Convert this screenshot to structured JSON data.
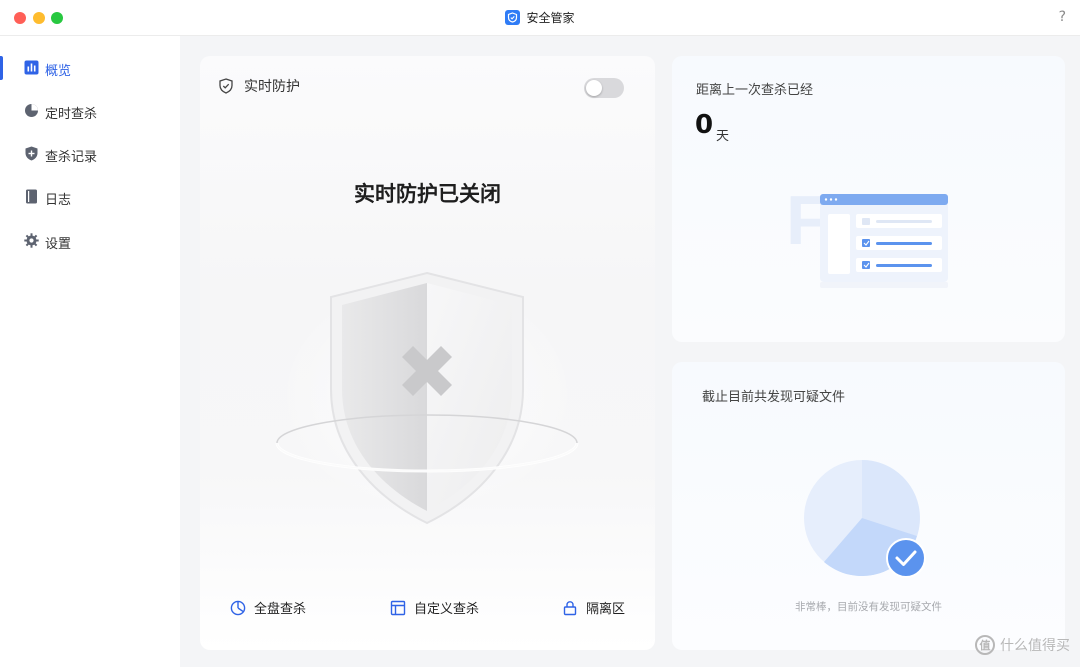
{
  "window": {
    "title": "安全管家",
    "help": "?"
  },
  "sidebar": {
    "items": [
      {
        "label": "概览",
        "icon": "overview-chart-icon",
        "active": true
      },
      {
        "label": "定时查杀",
        "icon": "clock-pie-icon",
        "active": false
      },
      {
        "label": "查杀记录",
        "icon": "shield-plus-icon",
        "active": false
      },
      {
        "label": "日志",
        "icon": "notebook-icon",
        "active": false
      },
      {
        "label": "设置",
        "icon": "gear-icon",
        "active": false
      }
    ]
  },
  "realtime": {
    "label": "实时防护",
    "enabled": false,
    "status_text": "实时防护已关闭"
  },
  "actions": {
    "full_scan": "全盘查杀",
    "custom_scan": "自定义查杀",
    "quarantine": "隔离区"
  },
  "last_scan": {
    "label": "距离上一次查杀已经",
    "value": "0",
    "unit": "天"
  },
  "suspicious": {
    "label": "截止目前共发现可疑文件",
    "footer": "非常棒，目前没有发现可疑文件"
  },
  "watermark": {
    "mark": "值",
    "text": "什么值得买"
  },
  "colors": {
    "accent": "#2f63e6",
    "brand": "#2f7cf6",
    "toggle_off": "#d9d9dc"
  }
}
